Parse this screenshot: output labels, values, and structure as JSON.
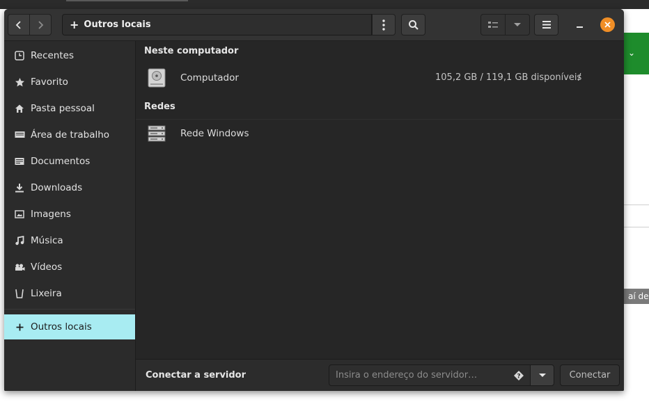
{
  "header": {
    "location_label": "Outros locais"
  },
  "sidebar": {
    "items": [
      {
        "label": "Recentes",
        "icon": "clock-icon"
      },
      {
        "label": "Favorito",
        "icon": "star-icon"
      },
      {
        "label": "Pasta pessoal",
        "icon": "home-icon"
      },
      {
        "label": "Área de trabalho",
        "icon": "desktop-icon"
      },
      {
        "label": "Documentos",
        "icon": "document-icon"
      },
      {
        "label": "Downloads",
        "icon": "download-icon"
      },
      {
        "label": "Imagens",
        "icon": "image-icon"
      },
      {
        "label": "Música",
        "icon": "music-icon"
      },
      {
        "label": "Vídeos",
        "icon": "video-icon"
      },
      {
        "label": "Lixeira",
        "icon": "trash-icon"
      }
    ],
    "other_locations": "Outros locais"
  },
  "main": {
    "sections": {
      "computer": "Neste computador",
      "networks": "Redes"
    },
    "computer_row": {
      "name": "Computador",
      "space_free": "105,2 GB",
      "space_sep": "/",
      "space_total": "119,1 GB disponíveis",
      "mount": "/"
    },
    "network_row": {
      "name": "Rede Windows"
    }
  },
  "bottom": {
    "connect_label": "Conectar a servidor",
    "server_placeholder": "Insira o endereço do servidor…",
    "server_value": "",
    "connect_button": "Conectar"
  },
  "background": {
    "snippet": "aí de"
  },
  "colors": {
    "accent": "#a8ecf2",
    "close": "#f08e26",
    "bg_green": "#1e8c2c"
  }
}
